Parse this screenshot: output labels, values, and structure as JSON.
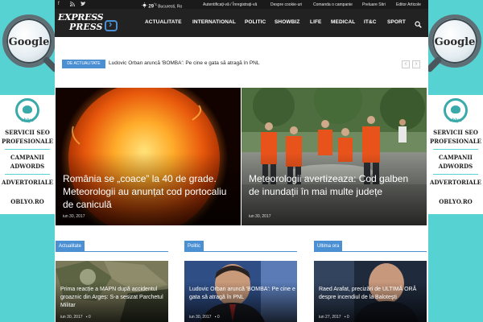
{
  "side_ad": {
    "brand": "Google",
    "logo_word": "oblyo",
    "lines": [
      "SERVICII SEO",
      "PROFESIONALE",
      "CAMPANII",
      "ADWORDS",
      "ADVERTORIALE"
    ],
    "url": "OBLYO.RO"
  },
  "topbar": {
    "social": [
      "f",
      "rss",
      "t"
    ],
    "temperature": "29",
    "degree": "°",
    "unit": "c",
    "city": "Bucuresti, Ro",
    "links": [
      "Autentificați-vă / Înregistrați-vă",
      "Despre cookie-uri",
      "Comanda o campanie",
      "Preluare Stiri",
      "Editor Articole"
    ]
  },
  "header": {
    "logo_line1": "EXPRESS",
    "logo_line2": "PRESS",
    "nav": [
      "ACTUALITATE",
      "INTERNATIONAL",
      "POLITIC",
      "SHOWBIZ",
      "LIFE",
      "MEDICAL",
      "IT&C",
      "SPORT"
    ]
  },
  "ticker": {
    "label": "DE ACTUALITATE",
    "text": "Ludovic Orban aruncă 'BOMBA': Pe cine e gata să atragă în PNL",
    "prev": "‹",
    "next": "›"
  },
  "featured": [
    {
      "title": "România se „coace” la 40 de grade. Meteorologii au anunțat cod portocaliu de caniculă",
      "date": "iun 30, 2017"
    },
    {
      "title": "Meteorologii avertizeaza: Cod galben de inundații în mai multe județe",
      "date": "iun 30, 2017"
    }
  ],
  "sections": [
    {
      "label": "Actualitate",
      "title": "Prima reacție a MAPN după accidentul groaznic din Argeș: S-a sesizat Parchetul Militar",
      "date": "iun 30, 2017",
      "comments": "0"
    },
    {
      "label": "Politic",
      "title": "Ludovic Orban aruncă 'BOMBA': Pe cine e gata să atragă în PNL",
      "date": "iun 30, 2017",
      "comments": "0"
    },
    {
      "label": "Ultima ora",
      "title": "Raed Arafat, precizări de ULTIMĂ ORĂ despre incendiul de la Baloteşti",
      "date": "iun 27, 2017",
      "comments": "0"
    }
  ],
  "colors": {
    "accent": "#4c90d4",
    "ad_background": "#57d2d2",
    "header": "#222222"
  }
}
